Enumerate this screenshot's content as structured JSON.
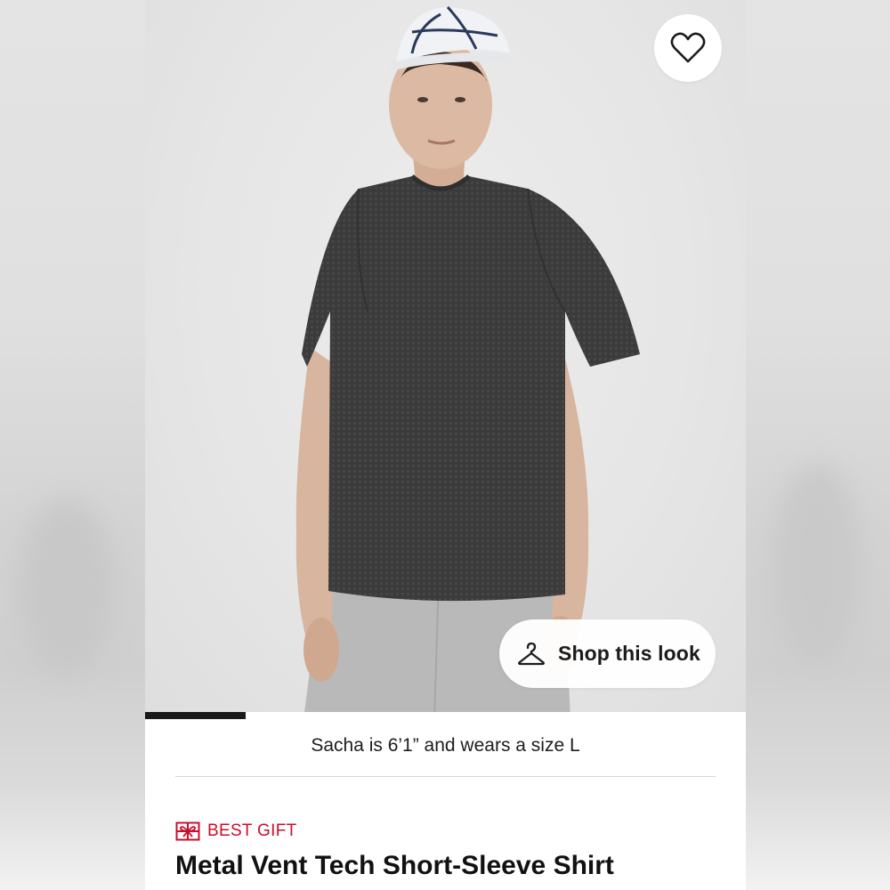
{
  "colors": {
    "accent_red": "#c8102e",
    "text_dark": "#111111",
    "background": "#ffffff"
  },
  "hero": {
    "favorite_icon": "heart-outline-icon",
    "shop_this_look": {
      "icon": "hanger-icon",
      "label": "Shop this look"
    },
    "carousel_progress": 0.167
  },
  "model_caption": "Sacha is 6’1” and wears a size L",
  "product": {
    "badge": {
      "icon": "gift-icon",
      "label": "BEST GIFT"
    },
    "title": "Metal Vent Tech Short-Sleeve Shirt"
  }
}
